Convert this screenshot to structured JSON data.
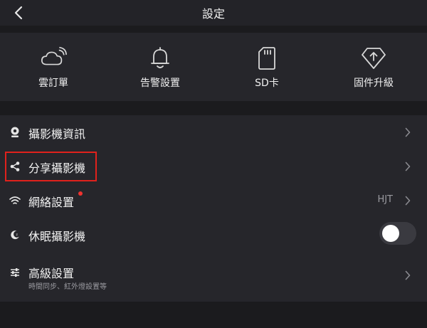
{
  "header": {
    "title": "設定",
    "back_icon": "chevron-left-icon"
  },
  "quick_actions": [
    {
      "label": "雲訂單",
      "icon": "cloud-icon"
    },
    {
      "label": "告警設置",
      "icon": "bell-icon"
    },
    {
      "label": "SD卡",
      "icon": "sd-card-icon"
    },
    {
      "label": "固件升級",
      "icon": "firmware-upgrade-icon"
    }
  ],
  "settings": {
    "camera_info": {
      "label": "攝影機資訊",
      "icon": "camera-icon"
    },
    "share_camera": {
      "label": "分享攝影機",
      "icon": "share-icon",
      "highlighted": true
    },
    "network": {
      "label": "網絡設置",
      "icon": "wifi-icon",
      "value": "HJT",
      "has_notification_dot": true
    },
    "sleep_camera": {
      "label": "休眠攝影機",
      "icon": "moon-icon",
      "enabled": false
    },
    "advanced": {
      "label": "高級設置",
      "sublabel": "時間同步、紅外燈設置等",
      "icon": "sliders-icon"
    }
  },
  "colors": {
    "background": "#1b1b1e",
    "panel": "#26262b",
    "highlight_border": "#e0211c",
    "notification_dot": "#f0332f"
  }
}
